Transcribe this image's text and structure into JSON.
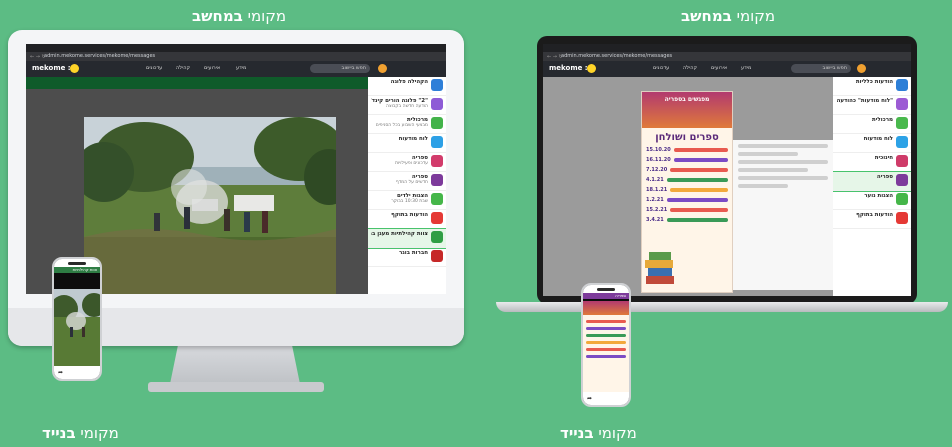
{
  "captions": {
    "top_left": {
      "plain": "מקומי ",
      "bold": "במחשב"
    },
    "top_right": {
      "plain": "מקומי ",
      "bold": "במחשב"
    },
    "bottom_left": {
      "plain": "מקומי ",
      "bold": "בנייד"
    },
    "bottom_right": {
      "plain": "מקומי ",
      "bold": "בנייד"
    }
  },
  "browser": {
    "url": "admin.mekome.services/mekome/messages"
  },
  "app": {
    "logo": "mekome :",
    "nav_items": [
      "עדכונים",
      "קהילה",
      "אירועים",
      "מידע"
    ],
    "search_placeholder": "חפש ביישוב"
  },
  "sidebar_imac": [
    {
      "title": "הקהילה פלוגה",
      "sub": "",
      "color": "#2f7fd8"
    },
    {
      "title": "\"2\" פלוגה הורים קינד\"",
      "sub": "הודעה חדשה בקבוצה",
      "color": "#8e5bd6"
    },
    {
      "title": "מרכולית",
      "sub": "מבצעי השבוע בכל הסניפים",
      "color": "#43b34a"
    },
    {
      "title": "לוח מודעות",
      "sub": "",
      "color": "#2da0e6"
    },
    {
      "title": "ספריה",
      "sub": "עדכונים ופעילויות",
      "color": "#d23b6b"
    },
    {
      "title": "ספריה",
      "sub": "חדשים על המדף",
      "color": "#7d3a9b"
    },
    {
      "title": "הצגות ילדים",
      "sub": "שבת 10:30 בבוקר",
      "color": "#45b649"
    },
    {
      "title": "הודעות בתוקף",
      "sub": "",
      "color": "#e53935"
    },
    {
      "title": "צוות קהילתיות מעגן ברוך",
      "sub": "",
      "color": "#2f9e44"
    },
    {
      "title": "חברות בוגר",
      "sub": "",
      "color": "#c62828"
    }
  ],
  "sidebar_laptop": [
    {
      "title": "הודעות כלליות",
      "sub": "",
      "color": "#2d7fd7"
    },
    {
      "title": "\"לוח מודעות\" כהודעה",
      "sub": "",
      "color": "#9c5bd4"
    },
    {
      "title": "מרכולית",
      "sub": "",
      "color": "#49b94d"
    },
    {
      "title": "לוח מודעות",
      "sub": "",
      "color": "#2da2e6"
    },
    {
      "title": "חינוכית",
      "sub": "",
      "color": "#cf3b69"
    },
    {
      "title": "ספריה",
      "sub": "",
      "color": "#7d3b9b"
    },
    {
      "title": "הצגות נוער",
      "sub": "",
      "color": "#45b649"
    },
    {
      "title": "הודעות בתוקף",
      "sub": "",
      "color": "#e53935"
    }
  ],
  "flyer": {
    "head": "מפגשים בספריה",
    "title": "ספרים ושולחן",
    "dates": [
      "15.10.20",
      "16.11.20",
      "7.12.20",
      "4.1.21",
      "18.1.21",
      "1.2.21",
      "15.2.21",
      "3.4.21"
    ],
    "bar_colors": [
      "#e85a4f",
      "#7b4bc4",
      "#e85a4f",
      "#3a9a57",
      "#f2a93b",
      "#7b4bc4",
      "#e85a4f",
      "#3a9a57"
    ]
  },
  "phone_imac": {
    "header": "צוות קהילתיות"
  },
  "phone_laptop": {
    "header": "ספריה"
  }
}
